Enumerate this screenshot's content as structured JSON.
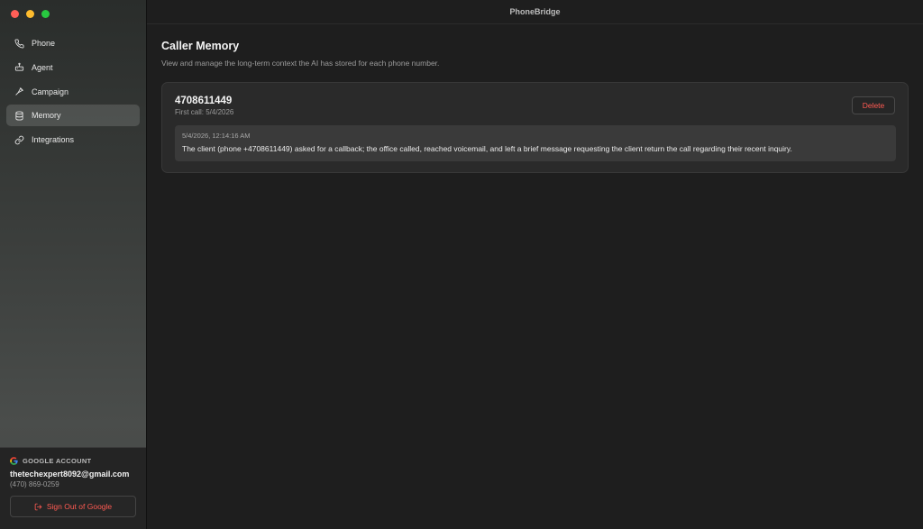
{
  "window": {
    "title": "PhoneBridge"
  },
  "sidebar": {
    "items": [
      {
        "label": "Phone",
        "icon": "phone-icon",
        "active": false
      },
      {
        "label": "Agent",
        "icon": "robot-icon",
        "active": false
      },
      {
        "label": "Campaign",
        "icon": "megaphone-icon",
        "active": false
      },
      {
        "label": "Memory",
        "icon": "database-icon",
        "active": true
      },
      {
        "label": "Integrations",
        "icon": "link-icon",
        "active": false
      }
    ]
  },
  "account": {
    "heading": "GOOGLE ACCOUNT",
    "email": "thetechexpert8092@gmail.com",
    "phone": "(470) 869-0259",
    "sign_out_label": "Sign Out of Google"
  },
  "main": {
    "title": "Caller Memory",
    "subtitle": "View and manage the long-term context the AI has stored for each phone number.",
    "callers": [
      {
        "number": "4708611449",
        "first_call": "First call: 5/4/2026",
        "delete_label": "Delete",
        "entries": [
          {
            "timestamp": "5/4/2026, 12:14:16 AM",
            "text": "The client (phone +4708611449) asked for a callback; the office called, reached voicemail, and left a brief message requesting the client return the call regarding their recent inquiry."
          }
        ]
      }
    ]
  },
  "colors": {
    "accent_red": "#ff5a52",
    "active_bg": "#3f4240"
  }
}
